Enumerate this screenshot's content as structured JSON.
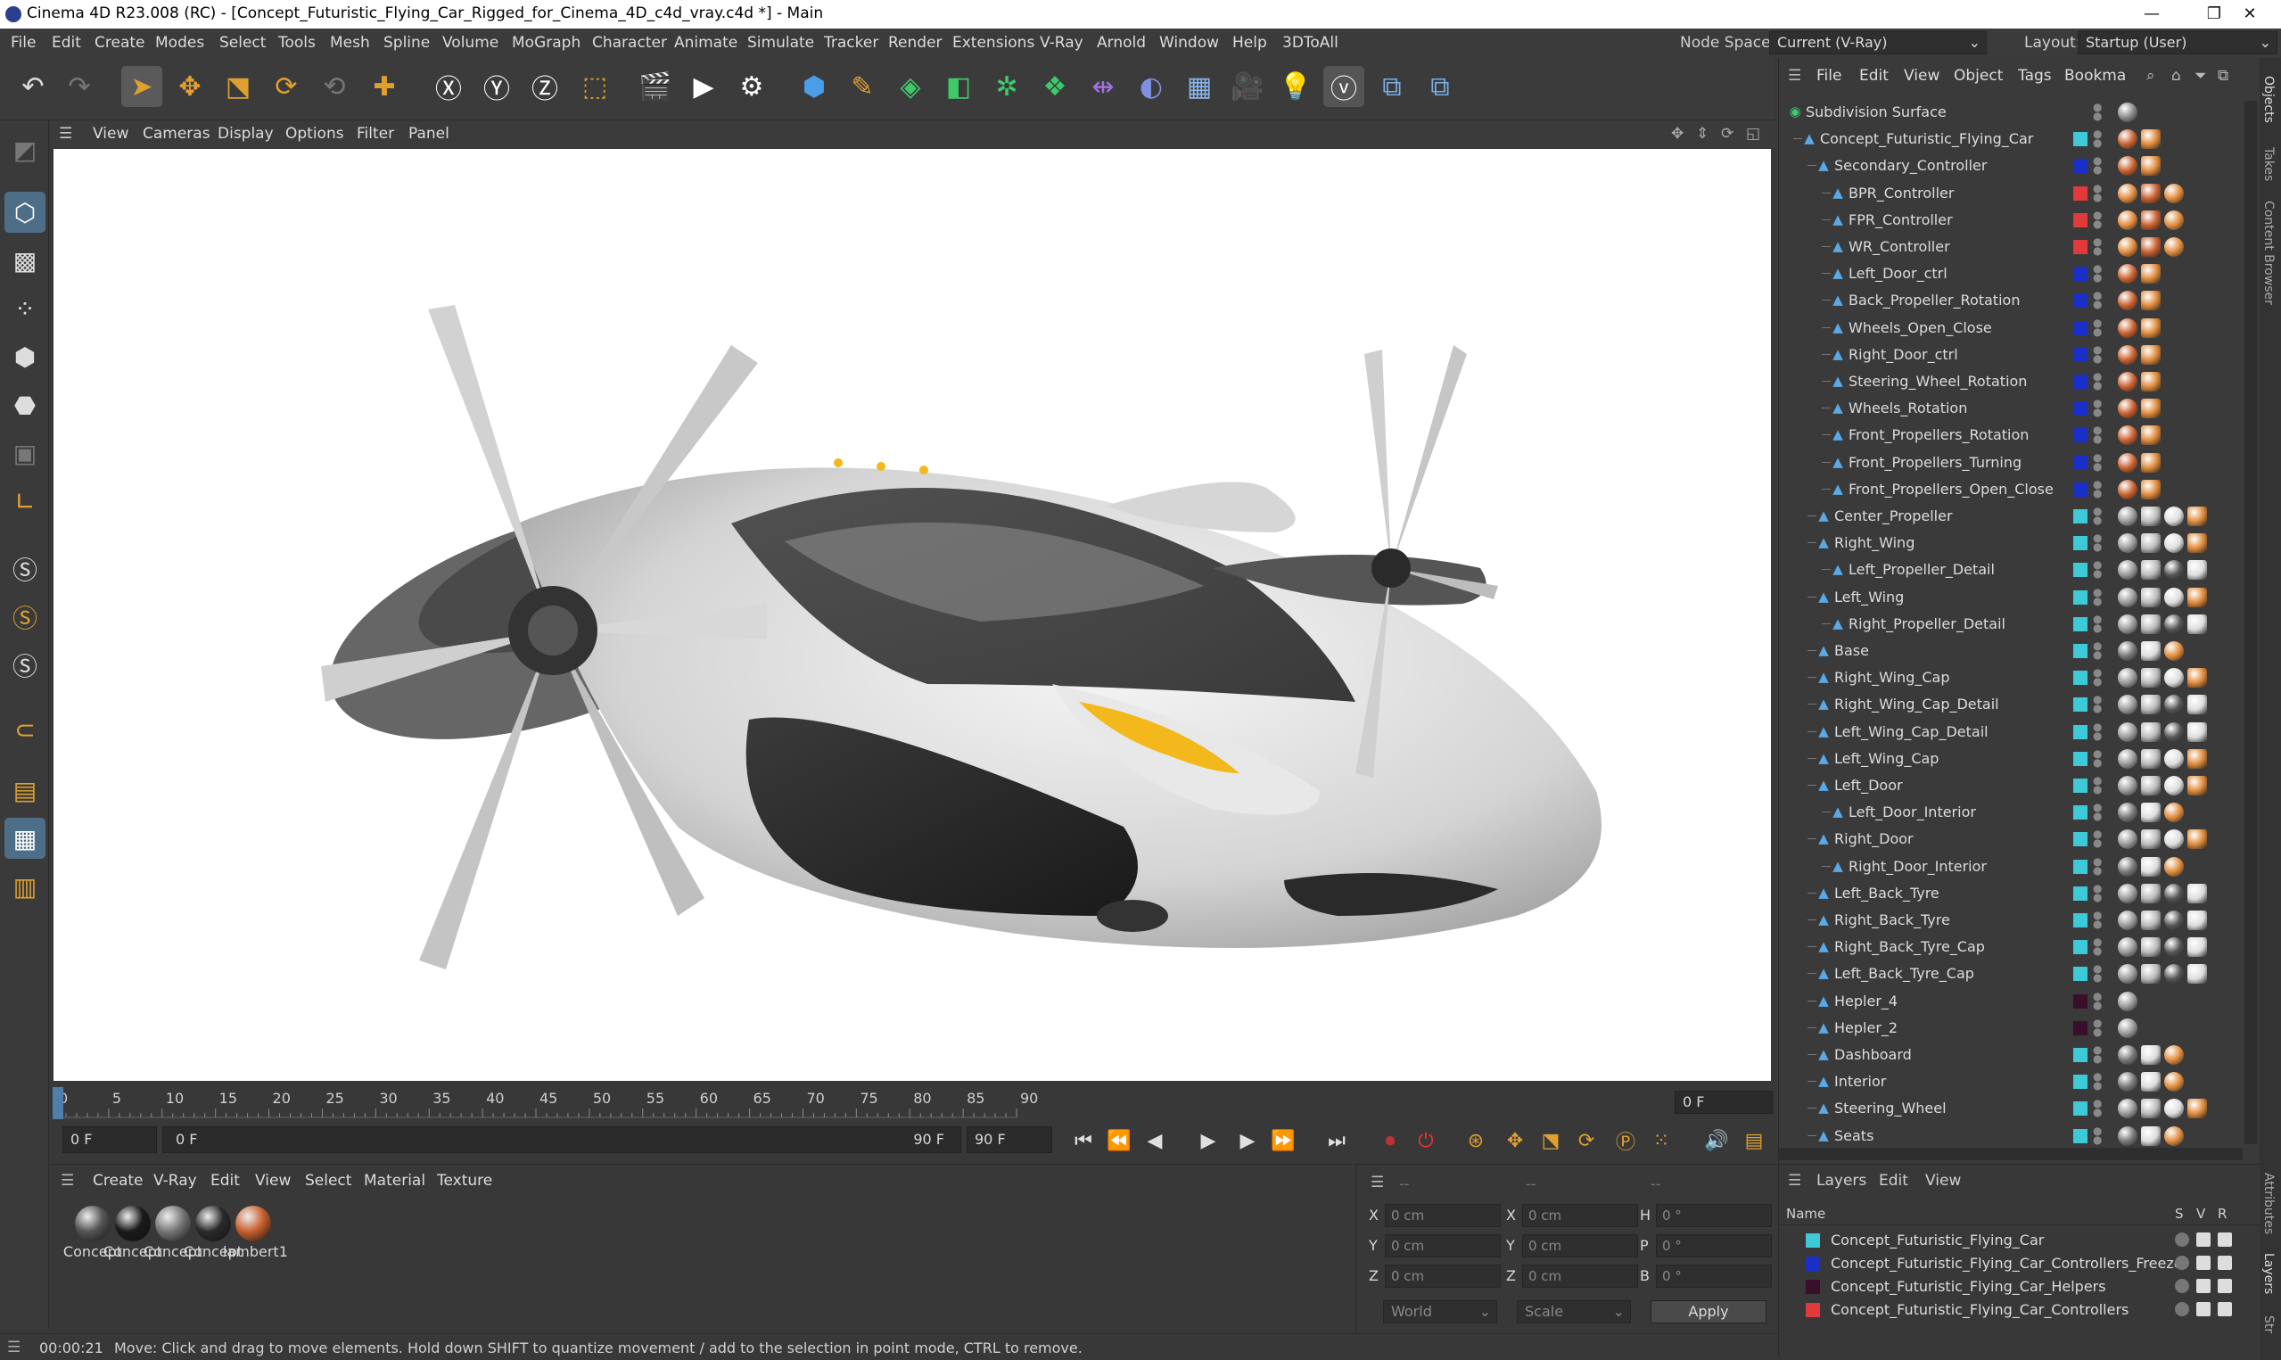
{
  "window": {
    "title": "Cinema 4D R23.008 (RC) - [Concept_Futuristic_Flying_Car_Rigged_for_Cinema_4D_c4d_vray.c4d *] - Main",
    "controls": [
      "—",
      "❐",
      "✕"
    ]
  },
  "menubar": [
    "File",
    "Edit",
    "Create",
    "Modes",
    "Select",
    "Tools",
    "Mesh",
    "Spline",
    "Volume",
    "MoGraph",
    "Character",
    "Animate",
    "Simulate",
    "Tracker",
    "Render",
    "Extensions",
    "V-Ray",
    "Arnold",
    "Window",
    "Help",
    "3DToAll"
  ],
  "nodespace": {
    "label": "Node Space:",
    "value": "Current (V-Ray)",
    "layout_label": "Layout:",
    "layout_value": "Startup (User)"
  },
  "viewport_menu": [
    "View",
    "Cameras",
    "Display",
    "Options",
    "Filter",
    "Panel"
  ],
  "timeline": {
    "ticks": [
      "0",
      "5",
      "10",
      "15",
      "20",
      "25",
      "30",
      "35",
      "40",
      "45",
      "50",
      "55",
      "60",
      "65",
      "70",
      "75",
      "80",
      "85",
      "90"
    ],
    "current_frame": "0 F",
    "start_field": "0 F",
    "range_start": "0 F",
    "range_end": "90 F",
    "end_field": "90 F",
    "playhead_frame": 0,
    "max_frame": 90
  },
  "material_manager": {
    "menu": [
      "Create",
      "V-Ray",
      "Edit",
      "View",
      "Select",
      "Material",
      "Texture"
    ],
    "materials": [
      {
        "label": "Concept",
        "color": "#555555"
      },
      {
        "label": "Concept",
        "color": "#1a1a1a"
      },
      {
        "label": "Concept",
        "color": "#777777"
      },
      {
        "label": "Concept",
        "color": "#2a2a2a"
      },
      {
        "label": "lambert1",
        "color": "#c8602e"
      }
    ]
  },
  "coordinates": {
    "labels": [
      "X",
      "Y",
      "Z"
    ],
    "pos": [
      "0 cm",
      "0 cm",
      "0 cm"
    ],
    "size": [
      "0 cm",
      "0 cm",
      "0 cm"
    ],
    "rot_labels": [
      "H",
      "P",
      "B"
    ],
    "rot": [
      "0 °",
      "0 °",
      "0 °"
    ],
    "header_dashes": [
      "--",
      "--",
      "--"
    ],
    "world": "World",
    "scale": "Scale",
    "apply": "Apply"
  },
  "status": {
    "time": "00:00:21",
    "message": "Move: Click and drag to move elements. Hold down SHIFT to quantize movement / add to the selection in point mode, CTRL to remove."
  },
  "object_manager": {
    "menu": [
      "File",
      "Edit",
      "View",
      "Object",
      "Tags",
      "Bookma"
    ],
    "rows": [
      {
        "name": "Subdivision Surface",
        "depth": 0,
        "color": "",
        "tags": "check"
      },
      {
        "name": "Concept_Futuristic_Flying_Car",
        "depth": 1,
        "color": "#3ec9d6",
        "tags": "orange"
      },
      {
        "name": "Secondary_Controller",
        "depth": 2,
        "color": "#1a2fc8",
        "tags": "orange"
      },
      {
        "name": "BPR_Controller",
        "depth": 3,
        "color": "#e03a3a",
        "tags": "ctrl"
      },
      {
        "name": "FPR_Controller",
        "depth": 3,
        "color": "#e03a3a",
        "tags": "ctrl"
      },
      {
        "name": "WR_Controller",
        "depth": 3,
        "color": "#e03a3a",
        "tags": "ctrl"
      },
      {
        "name": "Left_Door_ctrl",
        "depth": 3,
        "color": "#1a2fc8",
        "tags": "orange"
      },
      {
        "name": "Back_Propeller_Rotation",
        "depth": 3,
        "color": "#1a2fc8",
        "tags": "orange"
      },
      {
        "name": "Wheels_Open_Close",
        "depth": 3,
        "color": "#1a2fc8",
        "tags": "orange"
      },
      {
        "name": "Right_Door_ctrl",
        "depth": 3,
        "color": "#1a2fc8",
        "tags": "orange"
      },
      {
        "name": "Steering_Wheel_Rotation",
        "depth": 3,
        "color": "#1a2fc8",
        "tags": "orange"
      },
      {
        "name": "Wheels_Rotation",
        "depth": 3,
        "color": "#1a2fc8",
        "tags": "orange"
      },
      {
        "name": "Front_Propellers_Rotation",
        "depth": 3,
        "color": "#1a2fc8",
        "tags": "orange"
      },
      {
        "name": "Front_Propellers_Turning",
        "depth": 3,
        "color": "#1a2fc8",
        "tags": "orange"
      },
      {
        "name": "Front_Propellers_Open_Close",
        "depth": 3,
        "color": "#1a2fc8",
        "tags": "orange"
      },
      {
        "name": "Center_Propeller",
        "depth": 2,
        "color": "#3ec9d6",
        "tags": "mat"
      },
      {
        "name": "Right_Wing",
        "depth": 2,
        "color": "#3ec9d6",
        "tags": "mat"
      },
      {
        "name": "Left_Propeller_Detail",
        "depth": 3,
        "color": "#3ec9d6",
        "tags": "mat2"
      },
      {
        "name": "Left_Wing",
        "depth": 2,
        "color": "#3ec9d6",
        "tags": "mat"
      },
      {
        "name": "Right_Propeller_Detail",
        "depth": 3,
        "color": "#3ec9d6",
        "tags": "mat2"
      },
      {
        "name": "Base",
        "depth": 2,
        "color": "#3ec9d6",
        "tags": "mat3"
      },
      {
        "name": "Right_Wing_Cap",
        "depth": 2,
        "color": "#3ec9d6",
        "tags": "mat"
      },
      {
        "name": "Right_Wing_Cap_Detail",
        "depth": 2,
        "color": "#3ec9d6",
        "tags": "mat2"
      },
      {
        "name": "Left_Wing_Cap_Detail",
        "depth": 2,
        "color": "#3ec9d6",
        "tags": "mat2"
      },
      {
        "name": "Left_Wing_Cap",
        "depth": 2,
        "color": "#3ec9d6",
        "tags": "mat"
      },
      {
        "name": "Left_Door",
        "depth": 2,
        "color": "#3ec9d6",
        "tags": "mat"
      },
      {
        "name": "Left_Door_Interior",
        "depth": 3,
        "color": "#3ec9d6",
        "tags": "mat3"
      },
      {
        "name": "Right_Door",
        "depth": 2,
        "color": "#3ec9d6",
        "tags": "mat"
      },
      {
        "name": "Right_Door_Interior",
        "depth": 3,
        "color": "#3ec9d6",
        "tags": "mat3"
      },
      {
        "name": "Left_Back_Tyre",
        "depth": 2,
        "color": "#3ec9d6",
        "tags": "mat2"
      },
      {
        "name": "Right_Back_Tyre",
        "depth": 2,
        "color": "#3ec9d6",
        "tags": "mat2"
      },
      {
        "name": "Right_Back_Tyre_Cap",
        "depth": 2,
        "color": "#3ec9d6",
        "tags": "mat2"
      },
      {
        "name": "Left_Back_Tyre_Cap",
        "depth": 2,
        "color": "#3ec9d6",
        "tags": "mat2"
      },
      {
        "name": "Hepler_4",
        "depth": 2,
        "color": "#3a0f2a",
        "tags": "none"
      },
      {
        "name": "Hepler_2",
        "depth": 2,
        "color": "#3a0f2a",
        "tags": "none"
      },
      {
        "name": "Dashboard",
        "depth": 2,
        "color": "#3ec9d6",
        "tags": "mat3"
      },
      {
        "name": "Interior",
        "depth": 2,
        "color": "#3ec9d6",
        "tags": "mat3"
      },
      {
        "name": "Steering_Wheel",
        "depth": 2,
        "color": "#3ec9d6",
        "tags": "mat"
      },
      {
        "name": "Seats",
        "depth": 2,
        "color": "#3ec9d6",
        "tags": "mat3"
      }
    ]
  },
  "layers": {
    "menu": [
      "Layers",
      "Edit",
      "View"
    ],
    "header": {
      "name": "Name",
      "s": "S",
      "v": "V",
      "r": "R"
    },
    "items": [
      {
        "name": "Concept_Futuristic_Flying_Car",
        "color": "#3ec9d6"
      },
      {
        "name": "Concept_Futuristic_Flying_Car_Controllers_Freeze",
        "color": "#1a2fc8"
      },
      {
        "name": "Concept_Futuristic_Flying_Car_Helpers",
        "color": "#3a0f2a"
      },
      {
        "name": "Concept_Futuristic_Flying_Car_Controllers",
        "color": "#e03a3a"
      }
    ]
  },
  "side_tabs": [
    "Objects",
    "Takes",
    "Content Browser",
    "Attributes",
    "Layers",
    "Str"
  ]
}
